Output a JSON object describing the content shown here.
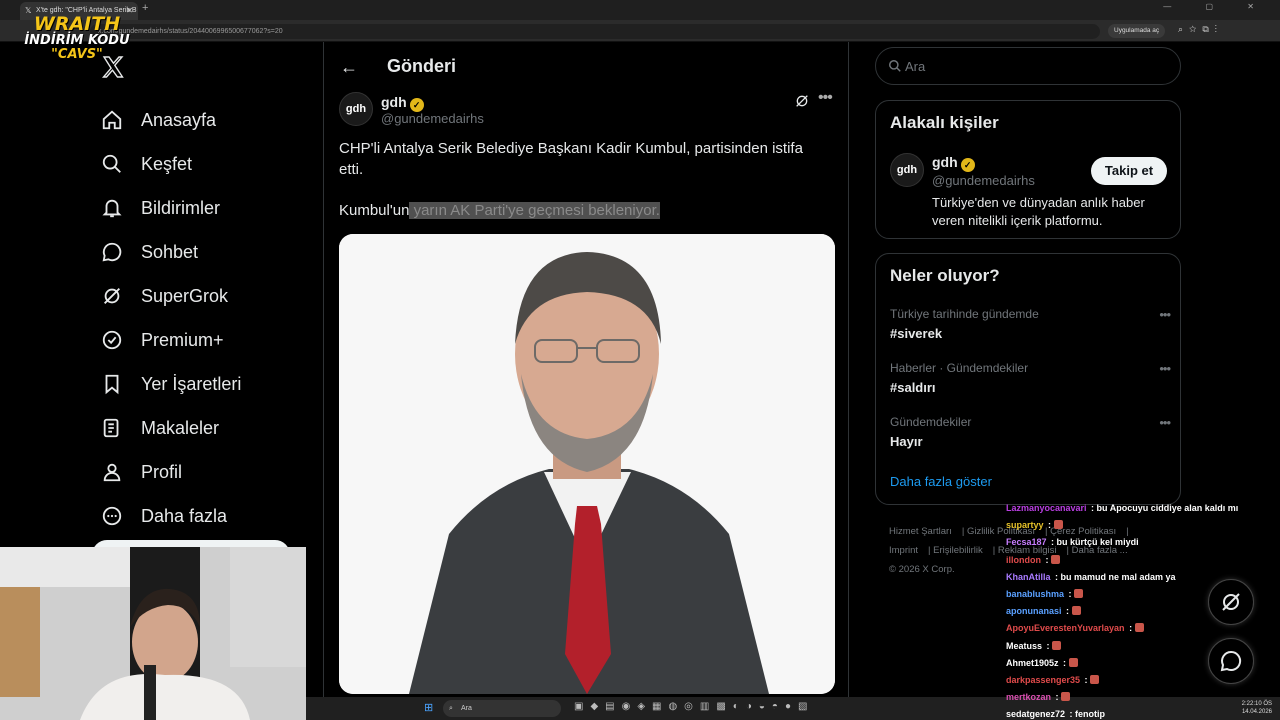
{
  "browser": {
    "tab_title": "X'te gdh: \"CHP'li Antalya Serik B",
    "url": "x.com/gundemedairhs/status/2044006996500677062?s=20",
    "app_button": "Uygulamada aç"
  },
  "overlay": {
    "brand": "WRAITH",
    "promo_line": "İNDİRİM KODU",
    "code": "\"CAVS\""
  },
  "nav": {
    "items": [
      {
        "label": "Anasayfa",
        "icon": "home-icon"
      },
      {
        "label": "Keşfet",
        "icon": "search-icon"
      },
      {
        "label": "Bildirimler",
        "icon": "bell-icon"
      },
      {
        "label": "Sohbet",
        "icon": "chat-icon"
      },
      {
        "label": "SuperGrok",
        "icon": "grok-icon"
      },
      {
        "label": "Premium+",
        "icon": "verified-badge-icon"
      },
      {
        "label": "Yer İşaretleri",
        "icon": "bookmark-icon"
      },
      {
        "label": "Makaleler",
        "icon": "article-icon"
      },
      {
        "label": "Profil",
        "icon": "person-icon"
      },
      {
        "label": "Daha fazla",
        "icon": "more-circle-icon"
      }
    ]
  },
  "post_page": {
    "title": "Gönderi",
    "author_name": "gdh",
    "author_handle": "@gundemedairhs",
    "avatar_text": "gdh",
    "text1": "CHP'li Antalya Serik Belediye Başkanı Kadir Kumbul, partisinden istifa etti.",
    "text2_plain": "Kumbul'un",
    "text2_highlight": " yarın AK Parti'ye geçmesi bekleniyor."
  },
  "right": {
    "search_placeholder": "Ara",
    "related": {
      "title": "Alakalı kişiler",
      "name": "gdh",
      "handle": "@gundemedairhs",
      "bio": "Türkiye'den ve dünyadan anlık haber veren nitelikli içerik platformu.",
      "follow_label": "Takip et"
    },
    "trends": {
      "title": "Neler oluyor?",
      "items": [
        {
          "meta": "Türkiye tarihinde gündemde",
          "name": "#siverek"
        },
        {
          "meta": "Haberler · Gündemdekiler",
          "name": "#saldırı"
        },
        {
          "meta": "Gündemdekiler",
          "name": "Hayır"
        }
      ],
      "show_more": "Daha fazla göster"
    },
    "footer": {
      "links": [
        "Hizmet Şartları",
        "Gizlilik Politikası",
        "Çerez Politikası",
        "Imprint",
        "Erişilebilirlik",
        "Reklam bilgisi",
        "Daha fazla ..."
      ],
      "copyright": "© 2026 X Corp."
    }
  },
  "chat": [
    {
      "user": "Lazmanyocanavari",
      "msg": "bu Apocuyu ciddiye alan kaldı mı",
      "color": "#b83fe0"
    },
    {
      "user": "supartyy",
      "msg": "",
      "color": "#e6c229"
    },
    {
      "user": "Fecsa187",
      "msg": "bu kürtçü kel miydi",
      "color": "#c77dff"
    },
    {
      "user": "illondon",
      "msg": "",
      "color": "#e04b4b"
    },
    {
      "user": "KhanAtilla",
      "msg": "bu mamud ne mal adam ya",
      "color": "#a97bff"
    },
    {
      "user": "banablushma",
      "msg": "",
      "color": "#5aa0ff"
    },
    {
      "user": "aponunanasi",
      "msg": "",
      "color": "#5aa0ff"
    },
    {
      "user": "ApoyuEverestenYuvarlayan",
      "msg": "",
      "color": "#e04b4b"
    },
    {
      "user": "Meatuss",
      "msg": "",
      "color": "#ffffff"
    },
    {
      "user": "Ahmet1905z",
      "msg": "",
      "color": "#ffffff"
    },
    {
      "user": "darkpassenger35",
      "msg": "",
      "color": "#e04b4b"
    },
    {
      "user": "mertkozan",
      "msg": "",
      "color": "#d94fb0"
    },
    {
      "user": "sedatgenez72",
      "msg": "fenotip",
      "color": "#ffffff"
    }
  ],
  "taskbar": {
    "search_label": "Ara",
    "time": "2:22:10 ÖS",
    "date": "14.04.2026"
  },
  "colors": {
    "background": "#000000",
    "border": "#2f3336",
    "muted": "#71767b",
    "accent": "#1d9bf0",
    "verified": "#e2b719"
  }
}
